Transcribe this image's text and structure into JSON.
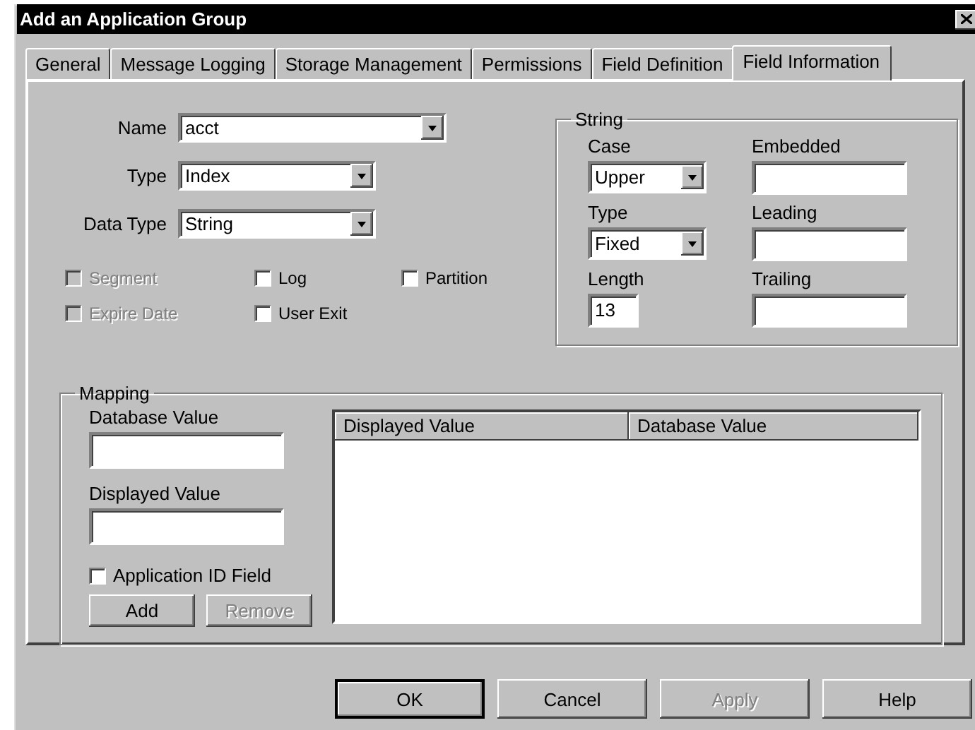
{
  "window": {
    "title": "Add an Application Group"
  },
  "tabs": [
    {
      "label": "General",
      "selected": false
    },
    {
      "label": "Message Logging",
      "selected": false
    },
    {
      "label": "Storage Management",
      "selected": false
    },
    {
      "label": "Permissions",
      "selected": false
    },
    {
      "label": "Field Definition",
      "selected": false
    },
    {
      "label": "Field Information",
      "selected": true
    }
  ],
  "fields": [
    {
      "kind": "combo",
      "label": "Name",
      "value": "acct"
    },
    {
      "kind": "combo",
      "label": "Type",
      "value": "Index"
    },
    {
      "kind": "combo",
      "label": "Data Type",
      "value": "String"
    }
  ],
  "options": [
    {
      "label": "Segment",
      "checked": false,
      "disabled": true
    },
    {
      "label": "Log",
      "checked": false,
      "disabled": false
    },
    {
      "label": "Partition",
      "checked": false,
      "disabled": false
    },
    {
      "label": "Expire Date",
      "checked": false,
      "disabled": true
    },
    {
      "label": "User Exit",
      "checked": false,
      "disabled": false
    }
  ],
  "string_group": {
    "title": "String",
    "fields": [
      {
        "kind": "combo",
        "label": "Case",
        "value": "Upper"
      },
      {
        "kind": "text",
        "label": "Embedded"
      },
      {
        "kind": "combo",
        "label": "Type",
        "value": "Fixed"
      },
      {
        "kind": "text",
        "label": "Leading"
      },
      {
        "kind": "number",
        "label": "Length",
        "value": "13"
      },
      {
        "kind": "text",
        "label": "Trailing"
      }
    ]
  },
  "mapping": {
    "title": "Mapping",
    "fields": [
      {
        "label": "Database Value"
      },
      {
        "label": "Displayed Value"
      }
    ],
    "checkbox": {
      "label": "Application ID Field",
      "checked": false
    },
    "buttons": [
      {
        "label": "Add",
        "disabled": false
      },
      {
        "label": "Remove",
        "disabled": true
      }
    ],
    "list": {
      "columns": [
        "Displayed Value",
        "Database Value"
      ]
    }
  },
  "buttons": [
    {
      "label": "OK",
      "disabled": false,
      "default": true
    },
    {
      "label": "Cancel",
      "disabled": false,
      "default": false
    },
    {
      "label": "Apply",
      "disabled": true,
      "default": false
    },
    {
      "label": "Help",
      "disabled": false,
      "default": false
    }
  ]
}
